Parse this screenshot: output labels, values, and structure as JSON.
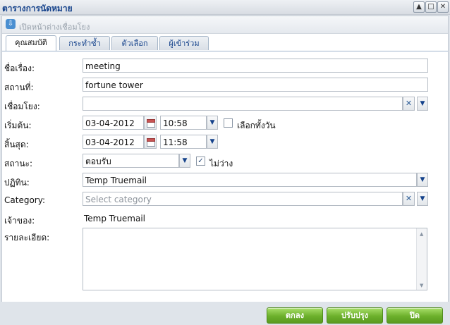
{
  "window": {
    "title": "ตารางการนัดหมาย"
  },
  "window_controls": {
    "minimize": "▲",
    "maximize": "□",
    "close": "✕"
  },
  "toolbar": {
    "open_link_label": "เปิดหน้าต่างเชื่อมโยง"
  },
  "tabs": [
    {
      "label": "คุณสมบัติ",
      "active": true
    },
    {
      "label": "กระทำซ้ำ",
      "active": false
    },
    {
      "label": "ตัวเลือก",
      "active": false
    },
    {
      "label": "ผู้เข้าร่วม",
      "active": false
    }
  ],
  "form": {
    "subject": {
      "label": "ชื่อเรื่อง:",
      "value": "meeting"
    },
    "location": {
      "label": "สถานที่:",
      "value": "fortune tower"
    },
    "link": {
      "label": "เชื่อมโยง:",
      "value": ""
    },
    "start": {
      "label": "เริ่มต้น:",
      "date": "03-04-2012",
      "time": "10:58"
    },
    "allday": {
      "label": "เลือกทั้งวัน",
      "checked": false
    },
    "end": {
      "label": "สิ้นสุด:",
      "date": "03-04-2012",
      "time": "11:58"
    },
    "status": {
      "label": "สถานะ:",
      "value": "ตอบรับ"
    },
    "busy": {
      "label": "ไม่ว่าง",
      "checked": true
    },
    "calendar": {
      "label": "ปฏิทิน:",
      "value": "Temp Truemail"
    },
    "category": {
      "label": "Category:",
      "placeholder": "Select category"
    },
    "owner": {
      "label": "เจ้าของ:",
      "value": "Temp Truemail"
    },
    "details": {
      "label": "รายละเอียด:",
      "value": ""
    }
  },
  "buttons": {
    "ok": "ตกลง",
    "update": "ปรับปรุง",
    "close": "ปิด"
  },
  "colors": {
    "accent": "#15428b",
    "button_green": "#6cb02b"
  }
}
